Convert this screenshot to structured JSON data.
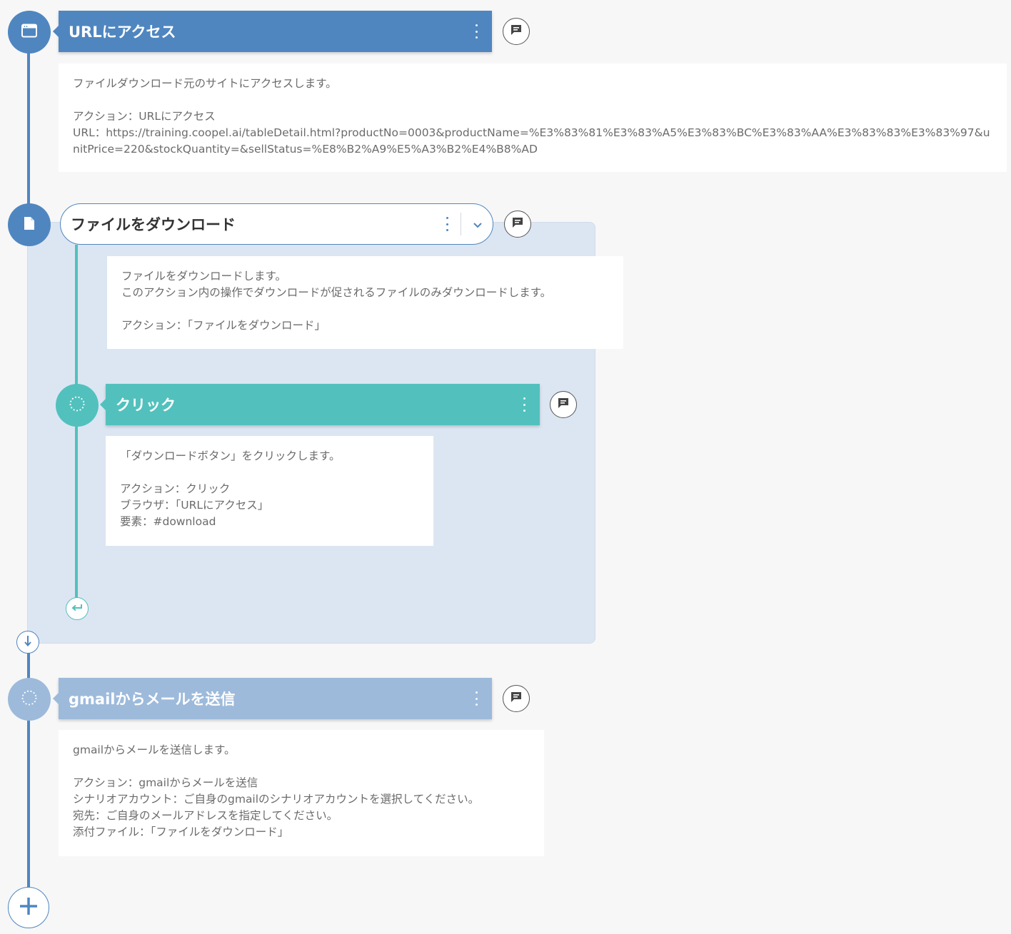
{
  "steps": [
    {
      "title": "URLにアクセス",
      "icon": "browser-window-icon",
      "description": "ファイルダウンロード元のサイトにアクセスします。\n\nアクション：URLにアクセス\nURL：https://training.coopel.ai/tableDetail.html?productNo=0003&productName=%E3%83%81%E3%83%A5%E3%83%BC%E3%83%AA%E3%83%83%E3%83%97&unitPrice=220&stockQuantity=&sellStatus=%E8%B2%A9%E5%A3%B2%E4%B8%AD"
    },
    {
      "title": "ファイルをダウンロード",
      "icon": "file-icon",
      "description": "ファイルをダウンロードします。\nこのアクション内の操作でダウンロードが促されるファイルのみダウンロードします。\n\nアクション：「ファイルをダウンロード」",
      "children": [
        {
          "title": "クリック",
          "icon": "dotted-circle-icon",
          "description": "「ダウンロードボタン」をクリックします。\n\nアクション：クリック\nブラウザ：「URLにアクセス」\n要素：#download"
        }
      ]
    },
    {
      "title": "gmailからメールを送信",
      "icon": "dotted-circle-icon",
      "description": "gmailからメールを送信します。\n\nアクション：gmailからメールを送信\nシナリオアカウント：ご自身のgmailのシナリオアカウントを選択してください。\n宛先：ご自身のメールアドレスを指定してください。\n添付ファイル：「ファイルをダウンロード」"
    }
  ],
  "colors": {
    "primary": "#4f86c0",
    "primary_light": "#9dbadb",
    "teal": "#52c1bd",
    "group_bg": "#dce6f2",
    "background": "#f7f7f7"
  }
}
